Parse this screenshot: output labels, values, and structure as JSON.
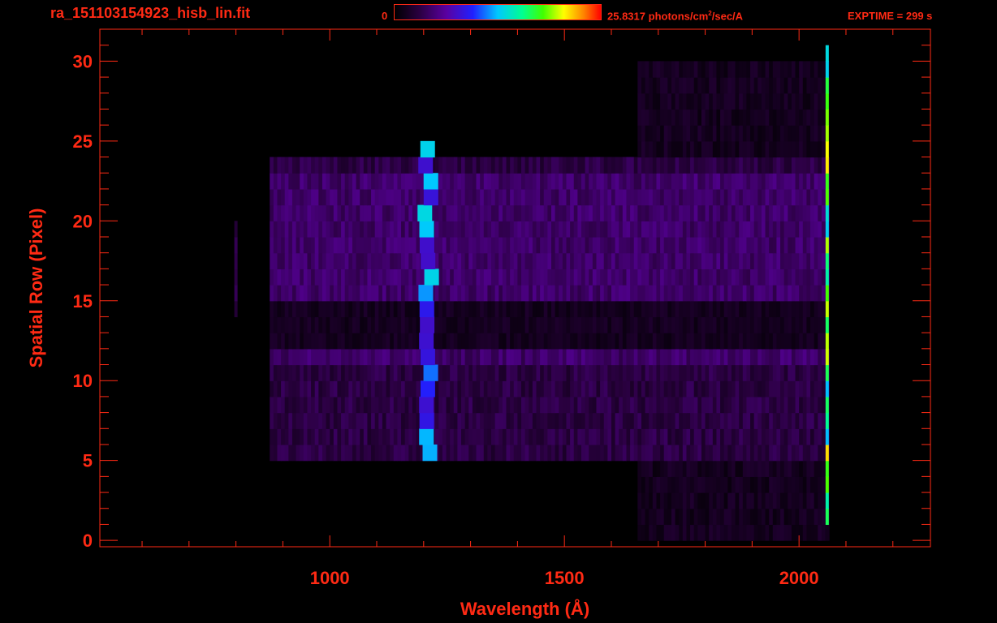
{
  "header": {
    "file_name": "ra_151103154923_hisb_lin.fit",
    "colorbar_min": "0",
    "colorbar_max_value": "25.8317",
    "colorbar_unit_pre": "photons/cm",
    "colorbar_unit_sup": "2",
    "colorbar_unit_post": "/sec/A",
    "exptime": "EXPTIME = 299 s"
  },
  "colors": {
    "foreground": "#ff2a14",
    "background": "#000000"
  },
  "chart_data": {
    "type": "heatmap",
    "xlabel": "Wavelength (Å)",
    "ylabel": "Spatial Row (Pixel)",
    "xlim": [
      510,
      2280
    ],
    "ylim": [
      -0.4,
      32
    ],
    "x_ticks": [
      1000,
      1500,
      2000
    ],
    "y_ticks": [
      0,
      5,
      10,
      15,
      20,
      25,
      30
    ],
    "colorbar": {
      "min": 0,
      "max": 25.8317
    },
    "row_range": [
      0,
      30
    ],
    "main_band": {
      "x_start": 870,
      "x_end": 2060,
      "row_min": 5,
      "row_max": 23,
      "bright_rows": [
        11,
        15,
        16,
        17,
        18,
        19,
        20,
        21,
        22
      ],
      "dark_rows": [
        12,
        13,
        14
      ]
    },
    "features": [
      {
        "name": "ly-alpha-line",
        "x": 1210,
        "row_min": 5,
        "row_max": 24,
        "peak_intensity": 14
      },
      {
        "name": "edge-line",
        "x": 2060,
        "row_min": 1,
        "row_max": 30,
        "peak_intensity": 22
      },
      {
        "name": "faint-arc",
        "x": 800,
        "row_min": 14,
        "row_max": 19,
        "peak_intensity": 4
      }
    ]
  }
}
